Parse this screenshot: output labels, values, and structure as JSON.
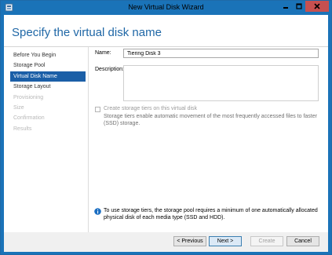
{
  "window": {
    "title": "New Virtual Disk Wizard"
  },
  "page": {
    "heading": "Specify the virtual disk name"
  },
  "nav": {
    "items": [
      {
        "label": "Before You Begin",
        "state": "normal"
      },
      {
        "label": "Storage Pool",
        "state": "normal"
      },
      {
        "label": "Virtual Disk Name",
        "state": "active"
      },
      {
        "label": "Storage Layout",
        "state": "normal"
      },
      {
        "label": "Provisioning",
        "state": "disabled"
      },
      {
        "label": "Size",
        "state": "disabled"
      },
      {
        "label": "Confirmation",
        "state": "disabled"
      },
      {
        "label": "Results",
        "state": "disabled"
      }
    ]
  },
  "form": {
    "name_label": "Name:",
    "name_value": "Tiering Disk 3",
    "description_label": "Description:",
    "description_value": "",
    "tiers_checkbox_label": "Create storage tiers on this virtual disk",
    "tiers_checked": false,
    "tiers_help": "Storage tiers enable automatic movement of the most frequently accessed files to faster (SSD) storage."
  },
  "info": {
    "text": "To use storage tiers, the storage pool requires a minimum of one automatically allocated physical disk of each media type (SSD and HDD)."
  },
  "buttons": {
    "previous": "< Previous",
    "next": "Next >",
    "create": "Create",
    "cancel": "Cancel"
  },
  "colors": {
    "accent": "#1a73b8",
    "nav_active": "#1b5fa7",
    "heading": "#1f67a6",
    "close": "#c75050"
  },
  "icons": [
    "app-icon",
    "minimize-icon",
    "maximize-icon",
    "close-icon",
    "info-icon"
  ]
}
